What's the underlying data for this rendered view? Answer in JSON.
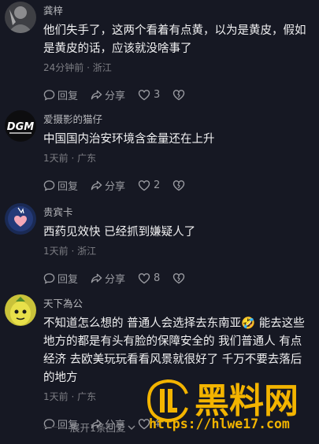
{
  "comments": [
    {
      "username": "龚梓",
      "content": "他们失手了，这两个看着有点黄，以为是黄皮，假如是黄皮的话，应该就没啥事了",
      "meta": "24分钟前 · 浙江",
      "reply": "回复",
      "share": "分享",
      "likes": "3"
    },
    {
      "username": "爱摄影的猫仔",
      "content": "中国国内治安环境含金量还在上升",
      "meta": "1天前 · 广东",
      "reply": "回复",
      "share": "分享",
      "likes": "2",
      "avatar_text": "DGM"
    },
    {
      "username": "贵宾卡",
      "content": "西药见效快 已经抓到嫌疑人了",
      "meta": "1天前 · 浙江",
      "reply": "回复",
      "share": "分享",
      "likes": "8"
    },
    {
      "username": "天下為公",
      "content": "不知道怎么想的 普通人会选择去东南亚🤣 能去这些地方的都是有头有脸的保障安全的 我们普通人 有点经济 去欧美玩玩看看风景就很好了 千万不要去落后的地方",
      "meta": "1天前 · 广东",
      "reply": "回复",
      "share": "分享",
      "likes": "4"
    }
  ],
  "expand_replies": "展开1条回复",
  "watermark": {
    "logo_text": "黑料网",
    "url": "https://hlwe17.com",
    "color": "#f3b400"
  },
  "icons": [
    "reply-icon",
    "share-icon",
    "like-icon",
    "dislike-icon",
    "chevron-down-icon"
  ]
}
